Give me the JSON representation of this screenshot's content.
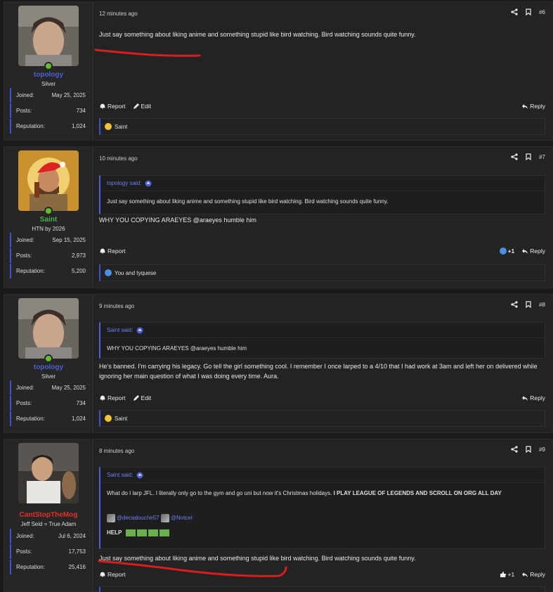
{
  "posts": [
    {
      "time": "12 minutes ago",
      "number": "#6",
      "author": {
        "name": "topology",
        "title": "Silver",
        "joined": "May 25, 2025",
        "posts": "734",
        "reputation": "1,024",
        "name_color": "#4f5fd6"
      },
      "message": "Just say something about liking anime and something stupid like bird watching. Bird watching sounds quite funny.",
      "actions": {
        "report": "Report",
        "edit": "Edit",
        "reply": "Reply"
      },
      "reactions": "Saint"
    },
    {
      "time": "10 minutes ago",
      "number": "#7",
      "author": {
        "name": "Saint",
        "title": "HTN by 2026",
        "joined": "Sep 15, 2025",
        "posts": "2,973",
        "reputation": "5,200",
        "name_color": "#4caf50"
      },
      "quote": {
        "author": "topology said:",
        "body": "Just say something about liking anime and something stupid like bird watching. Bird watching sounds quite funny."
      },
      "message": "WHY YOU COPYING ARAEYES @araeyes humble him",
      "actions": {
        "report": "Report",
        "reply": "Reply",
        "like_count": "+1"
      },
      "reactions": "You and tyquese"
    },
    {
      "time": "9 minutes ago",
      "number": "#8",
      "author": {
        "name": "topology",
        "title": "Silver",
        "joined": "May 25, 2025",
        "posts": "734",
        "reputation": "1,024",
        "name_color": "#4f5fd6"
      },
      "quote": {
        "author": "Saint said:",
        "body": "WHY YOU COPYING ARAEYES @araeyes humble him"
      },
      "message": "He's banned. I'm carrying his legacy. Go tell the girl something cool. I remember I once larped to a 4/10 that I had work at 3am and left her on delivered while ignoring her main question of what I was doing every time. Aura.",
      "actions": {
        "report": "Report",
        "edit": "Edit",
        "reply": "Reply"
      },
      "reactions": "Saint"
    },
    {
      "time": "8 minutes ago",
      "number": "#9",
      "author": {
        "name": "CantStopTheMog",
        "title": "Jeff Seid = True Adam",
        "joined": "Jul 6, 2024",
        "posts": "17,753",
        "reputation": "25,416",
        "name_color": "#e0302a"
      },
      "quote": {
        "author": "Saint said:",
        "body_plain": "What do I larp JFL. I literally only go to the gym and go uni but now it's Christmas holidays. ",
        "body_bold": "I PLAY LEAGUE OF LEGENDS AND SCROLL ON ORG ALL DAY",
        "mention1": "@decadouche57",
        "mention2": "@Notcel",
        "help": "HELP"
      },
      "message": "Just say something about liking anime and something stupid like bird watching. Bird watching sounds quite funny.",
      "actions": {
        "report": "Report",
        "reply": "Reply",
        "like_count": "+1"
      }
    }
  ],
  "labels": {
    "joined": "Joined:",
    "posts": "Posts:",
    "reputation": "Reputation:"
  },
  "colors": {
    "accent": "#4f5fd6",
    "scribble": "#d61f1f",
    "online": "#5fbf2f"
  },
  "icons": [
    "share-icon",
    "bookmark-icon",
    "report-bell-icon",
    "edit-pencil-icon",
    "reply-arrow-icon",
    "like-icon",
    "quote-arrow-icon"
  ]
}
